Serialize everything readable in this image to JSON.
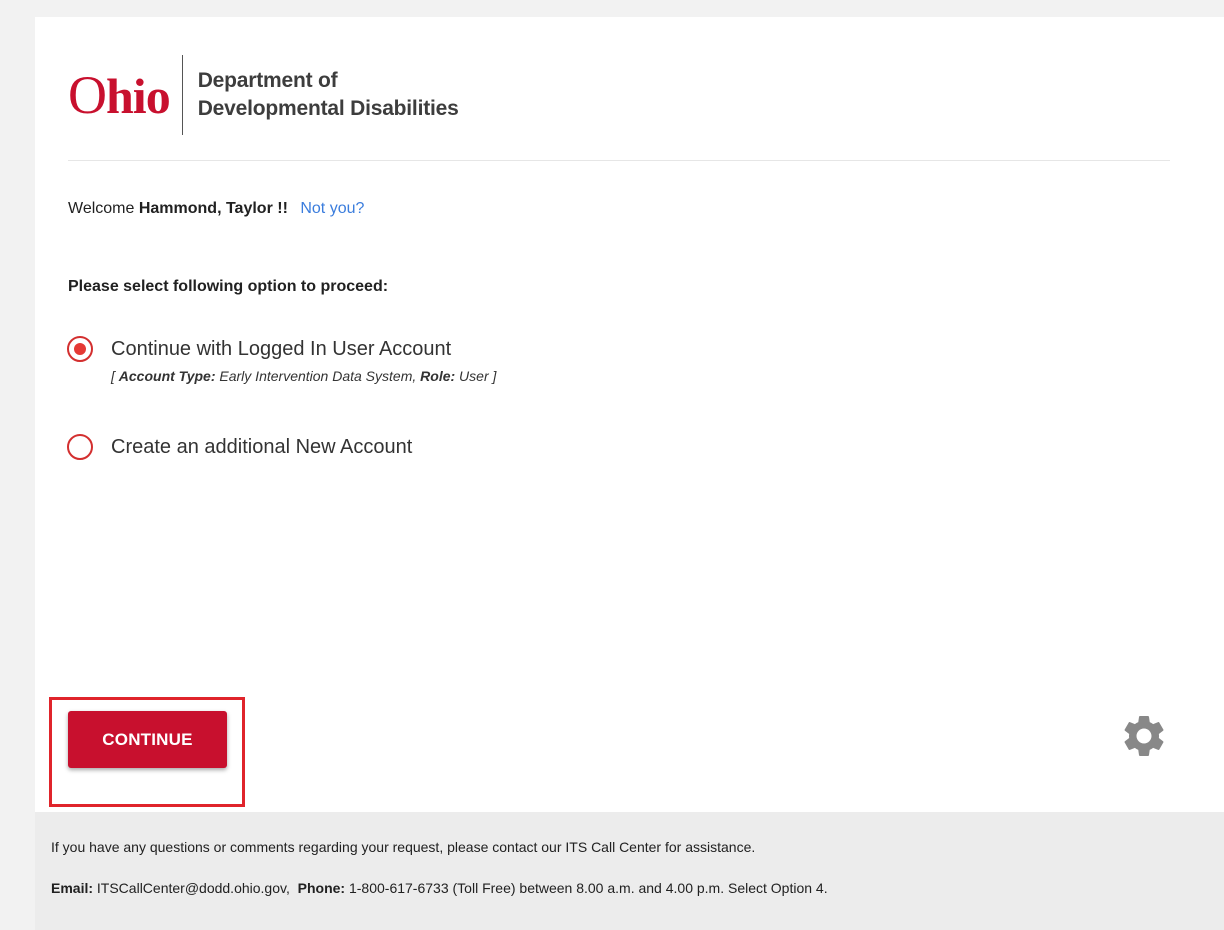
{
  "header": {
    "logo_wordmark_o": "O",
    "logo_wordmark_rest": "hio",
    "department_line1": "Department of",
    "department_line2": "Developmental Disabilities"
  },
  "welcome": {
    "prefix": "Welcome",
    "user_name": "Hammond, Taylor !!",
    "not_you_link": "Not you?"
  },
  "prompt": "Please select following option to proceed:",
  "options": [
    {
      "label": "Continue with Logged In User Account",
      "checked": true,
      "sub_open": "[",
      "account_type_label": "Account Type:",
      "account_type_value": "Early Intervention Data System,",
      "role_label": "Role:",
      "role_value": "User ]"
    },
    {
      "label": "Create an additional New Account",
      "checked": false
    }
  ],
  "continue_button": "CONTINUE",
  "settings_icon": "gear-icon",
  "footer": {
    "help_text": "If you have any questions or comments regarding your request, please contact our ITS Call Center for assistance.",
    "email_label": "Email:",
    "email_value": "ITSCallCenter@dodd.ohio.gov,",
    "phone_label": "Phone:",
    "phone_value": "1-800-617-6733 (Toll Free) between 8.00 a.m. and 4.00 p.m. Select Option 4."
  },
  "colors": {
    "brand_red": "#c8102e",
    "link_blue": "#3b7ddd",
    "radio_red": "#d32f2f",
    "highlight_red": "#e0242b",
    "footer_bg": "#ececec"
  }
}
